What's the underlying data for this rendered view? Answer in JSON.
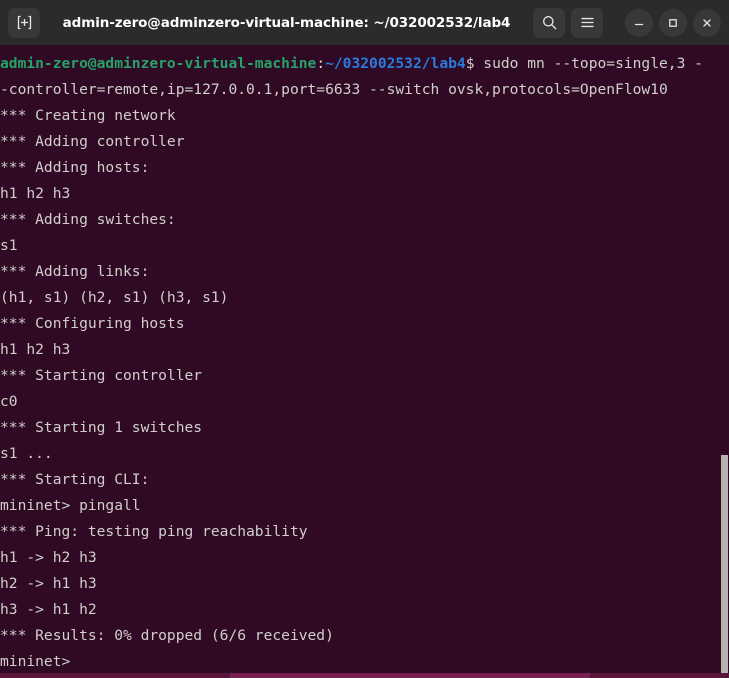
{
  "window": {
    "title": "admin-zero@adminzero-virtual-machine: ~/032002532/lab4",
    "new_tab_label": "New Tab",
    "search_label": "Search",
    "menu_label": "Menu",
    "minimize_label": "Minimize",
    "maximize_label": "Maximize",
    "close_label": "Close"
  },
  "colors": {
    "titlebar_bg": "#2b2b2b",
    "terminal_bg": "#300a24",
    "prompt_user": "#26a269",
    "prompt_path": "#2a7bde",
    "output_text": "#d0cfcc",
    "scrollbar": "#b6b2ae",
    "bottom_strip": "#5a1638"
  },
  "terminal": {
    "prompt": {
      "user_host": "admin-zero@adminzero-virtual-machine",
      "separator": ":",
      "path": "~/032002532/lab4",
      "sigil": "$ ",
      "command_part1": "sudo mn --topo=single,3 -",
      "command_part2": "-controller=remote,ip=127.0.0.1,port=6633 --switch ovsk,protocols=OpenFlow10"
    },
    "output_lines": [
      "*** Creating network",
      "*** Adding controller",
      "*** Adding hosts:",
      "h1 h2 h3",
      "*** Adding switches:",
      "s1",
      "*** Adding links:",
      "(h1, s1) (h2, s1) (h3, s1)",
      "*** Configuring hosts",
      "h1 h2 h3",
      "*** Starting controller",
      "c0",
      "*** Starting 1 switches",
      "s1 ...",
      "*** Starting CLI:"
    ],
    "mininet_prompt_1": "mininet> ",
    "mininet_command_1": "pingall",
    "ping_lines": [
      "*** Ping: testing ping reachability",
      "h1 -> h2 h3",
      "h2 -> h1 h3",
      "h3 -> h1 h2",
      "*** Results: 0% dropped (6/6 received)"
    ],
    "mininet_prompt_2": "mininet>"
  }
}
